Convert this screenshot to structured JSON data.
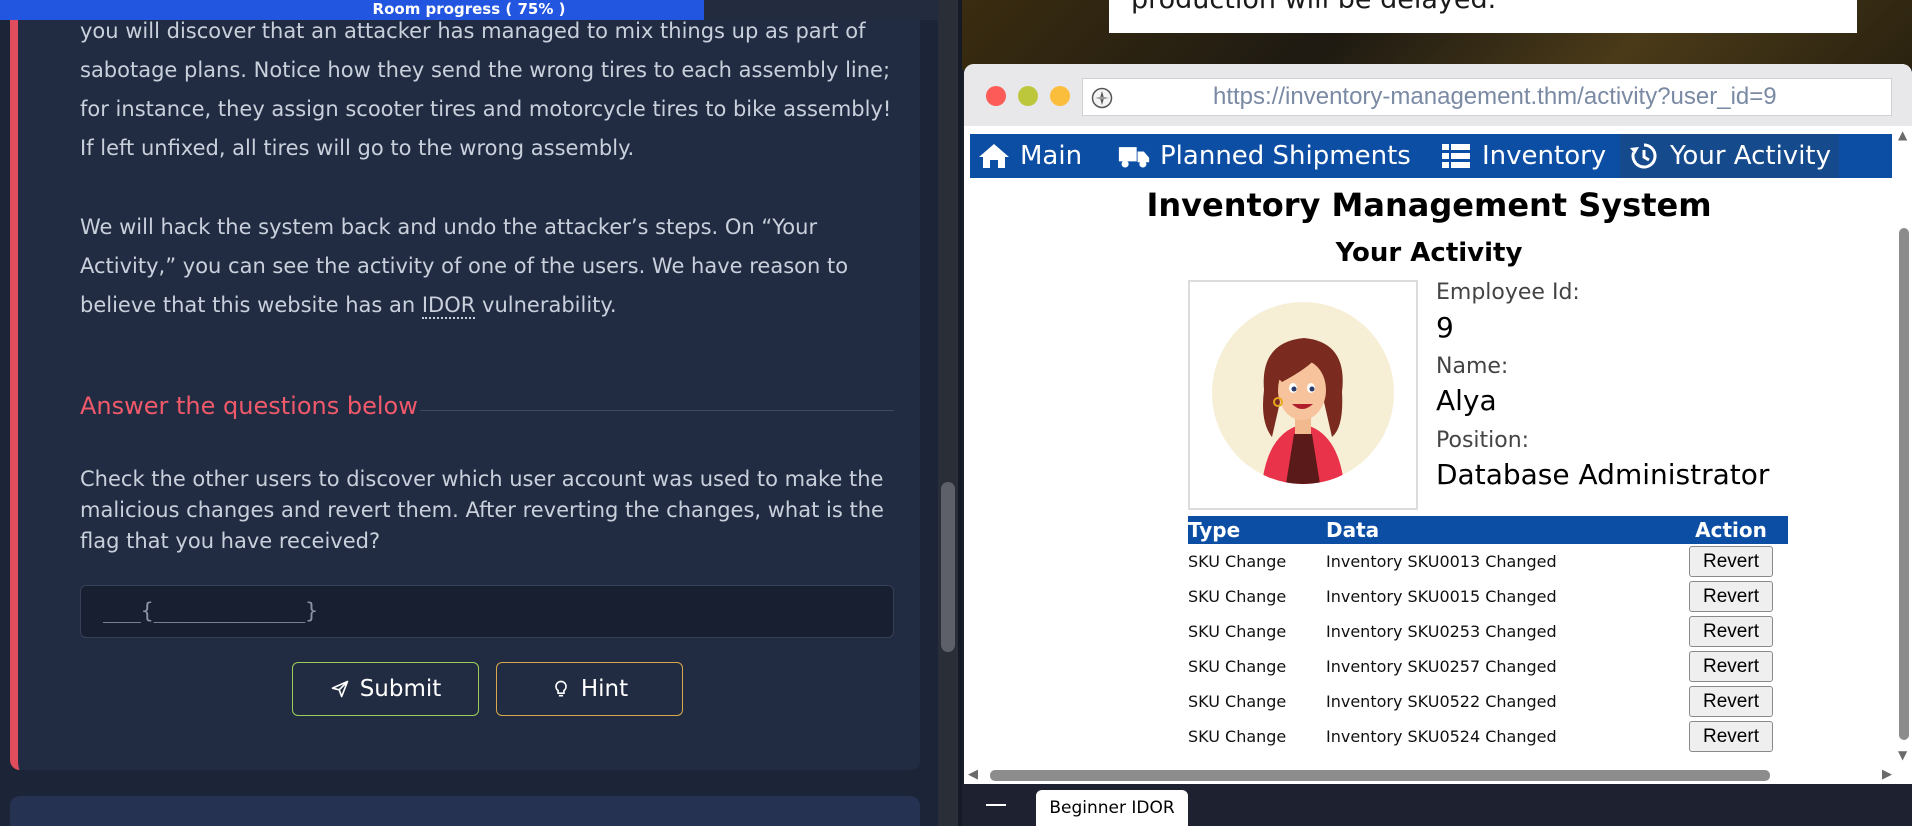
{
  "room": {
    "progress_label": "Room progress ( 75% )",
    "progress_fraction": 0.75
  },
  "task": {
    "paragraph1": "Inventory Management System. If you click on the “Planned Shipments” tab, you will discover that an attacker has managed to mix things up as part of sabotage plans. Notice how they send the wrong tires to each assembly line; for instance, they assign scooter tires and motorcycle tires to bike assembly! If left unfixed, all tires will go to the wrong assembly.",
    "paragraph2_before": "We will hack the system back and undo the attacker’s steps. On “Your Activity,” you can see the activity of one of the users. We have reason to believe that this website has an ",
    "paragraph2_abbr": "IDOR",
    "paragraph2_after": " vulnerability.",
    "answer_heading": "Answer the questions below",
    "question": "Check the other users to discover which user account was used to make the malicious changes and revert them. After reverting the changes, what is the flag that you have received?",
    "answer_placeholder": "___{____________}",
    "submit_label": "Submit",
    "hint_label": "Hint",
    "accent_color": "#e04e5e"
  },
  "vm": {
    "top_note_text": "production will be delayed.",
    "browser": {
      "url": "https://inventory-management.thm/activity?user_id=9"
    },
    "nav": [
      {
        "label": "Main",
        "icon": "home-icon"
      },
      {
        "label": "Planned Shipments",
        "icon": "truck-icon"
      },
      {
        "label": "Inventory",
        "icon": "list-icon"
      },
      {
        "label": "Your Activity",
        "icon": "history-icon"
      }
    ],
    "app_title": "Inventory Management System",
    "section_title": "Your Activity",
    "profile": {
      "employee_id_label": "Employee Id:",
      "employee_id": "9",
      "name_label": "Name:",
      "name": "Alya",
      "position_label": "Position:",
      "position": "Database Administrator"
    },
    "table": {
      "headers": [
        "Type",
        "Data",
        "Action"
      ],
      "rows": [
        {
          "type": "SKU Change",
          "data": "Inventory SKU0013 Changed",
          "action": "Revert"
        },
        {
          "type": "SKU Change",
          "data": "Inventory SKU0015 Changed",
          "action": "Revert"
        },
        {
          "type": "SKU Change",
          "data": "Inventory SKU0253 Changed",
          "action": "Revert"
        },
        {
          "type": "SKU Change",
          "data": "Inventory SKU0257 Changed",
          "action": "Revert"
        },
        {
          "type": "SKU Change",
          "data": "Inventory SKU0522 Changed",
          "action": "Revert"
        },
        {
          "type": "SKU Change",
          "data": "Inventory SKU0524 Changed",
          "action": "Revert"
        }
      ]
    },
    "nav_color": "#0d4ea5",
    "taskbar_tab": "Beginner IDOR"
  }
}
